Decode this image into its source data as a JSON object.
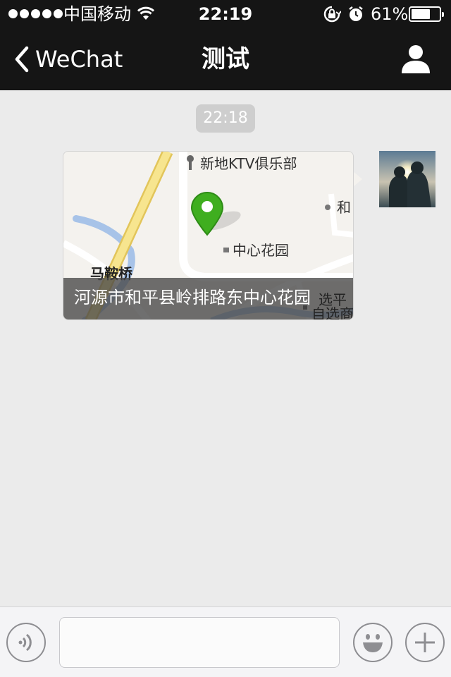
{
  "status_bar": {
    "carrier": "中国移动",
    "time": "22:19",
    "battery_percent": "61%",
    "battery_level": 0.61,
    "icons": [
      "signal-dots",
      "wifi-icon",
      "rotation-lock-icon",
      "alarm-icon",
      "battery-icon"
    ]
  },
  "nav": {
    "back_label": "WeChat",
    "title": "测试",
    "right_icon": "profile-icon"
  },
  "chat": {
    "timestamp": "22:18",
    "location_message": {
      "address": "河源市和平县岭排路东中心花园",
      "map_labels": {
        "ktv": "新地KTV俱乐部",
        "he": "和",
        "center_garden": "中心花园",
        "ma_an_qiao": "马鞍桥",
        "zixuan_1": "选平",
        "zixuan_2": "自选商"
      },
      "pin_color": "#3fae1f"
    }
  },
  "toolbar": {
    "voice_icon": "voice-icon",
    "emoji_icon": "emoji-icon",
    "plus_icon": "plus-icon",
    "input_value": ""
  }
}
